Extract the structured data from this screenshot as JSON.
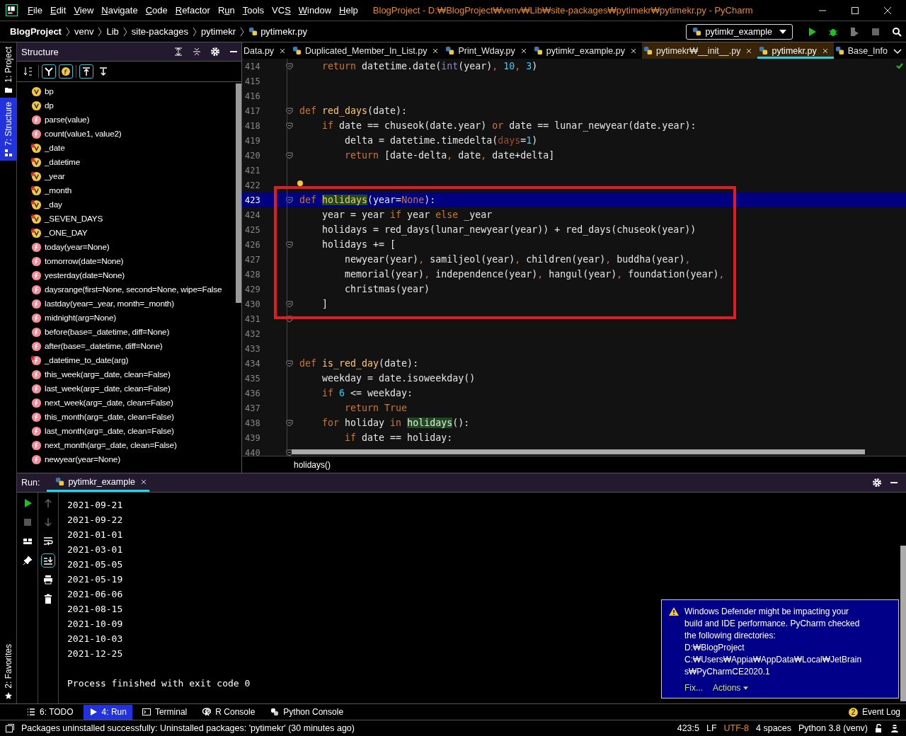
{
  "window": {
    "title": "BlogProject - D:₩BlogProject₩venv₩Lib₩site-packages₩pytimekr₩pytimekr.py - PyCharm"
  },
  "menu": [
    {
      "key": "F",
      "after": "ile"
    },
    {
      "key": "E",
      "after": "dit"
    },
    {
      "key": "V",
      "after": "iew"
    },
    {
      "key": "N",
      "after": "avigate"
    },
    {
      "key": "C",
      "after": "ode"
    },
    {
      "key": "R",
      "after": "efactor"
    },
    {
      "before": "R",
      "key": "u",
      "after": "n"
    },
    {
      "key": "T",
      "after": "ools"
    },
    {
      "before": "VC",
      "key": "S"
    },
    {
      "key": "W",
      "after": "indow"
    },
    {
      "key": "H",
      "after": "elp"
    }
  ],
  "breadcrumbs": [
    {
      "label": "BlogProject",
      "kind": "root"
    },
    {
      "label": "venv",
      "kind": "folder"
    },
    {
      "label": "Lib",
      "kind": "folder"
    },
    {
      "label": "site-packages",
      "kind": "folder"
    },
    {
      "label": "pytimekr",
      "kind": "folder"
    },
    {
      "label": "pytimekr.py",
      "kind": "file"
    }
  ],
  "run_config": {
    "label": "pytimkr_example"
  },
  "side_stripe": [
    {
      "label": "1: Project",
      "selected": false
    },
    {
      "label": "7: Structure",
      "selected": true
    }
  ],
  "favorites": {
    "label": "2: Favorites"
  },
  "structure": {
    "title": "Structure",
    "toolbar": [
      {
        "kind": "sort",
        "on": false
      },
      {
        "kind": "fields",
        "on": true
      },
      {
        "kind": "func",
        "on": true
      },
      {
        "kind": "up",
        "on": true
      },
      {
        "kind": "down",
        "on": false
      }
    ],
    "items": [
      {
        "label": "bp",
        "kind": "var",
        "private": false
      },
      {
        "label": "dp",
        "kind": "var",
        "private": false
      },
      {
        "label": "parse(value)",
        "kind": "func",
        "private": false
      },
      {
        "label": "count(value1, value2)",
        "kind": "func",
        "private": false
      },
      {
        "label": "_date",
        "kind": "var",
        "private": true
      },
      {
        "label": "_datetime",
        "kind": "var",
        "private": true
      },
      {
        "label": "_year",
        "kind": "var",
        "private": true
      },
      {
        "label": "_month",
        "kind": "var",
        "private": true
      },
      {
        "label": "_day",
        "kind": "var",
        "private": true
      },
      {
        "label": "_SEVEN_DAYS",
        "kind": "var",
        "private": true
      },
      {
        "label": "_ONE_DAY",
        "kind": "var",
        "private": true
      },
      {
        "label": "today(year=None)",
        "kind": "func",
        "private": false
      },
      {
        "label": "tomorrow(date=None)",
        "kind": "func",
        "private": false
      },
      {
        "label": "yesterday(date=None)",
        "kind": "func",
        "private": false
      },
      {
        "label": "daysrange(first=None, second=None, wipe=False",
        "kind": "func",
        "private": false
      },
      {
        "label": "lastday(year=_year, month=_month)",
        "kind": "func",
        "private": false
      },
      {
        "label": "midnight(arg=None)",
        "kind": "func",
        "private": false
      },
      {
        "label": "before(base=_datetime, diff=None)",
        "kind": "func",
        "private": false
      },
      {
        "label": "after(base=_datetime, diff=None)",
        "kind": "func",
        "private": false
      },
      {
        "label": "_datetime_to_date(arg)",
        "kind": "func",
        "private": true
      },
      {
        "label": "this_week(arg=_date, clean=False)",
        "kind": "func",
        "private": false
      },
      {
        "label": "last_week(arg=_date, clean=False)",
        "kind": "func",
        "private": false
      },
      {
        "label": "next_week(arg=_date, clean=False)",
        "kind": "func",
        "private": false
      },
      {
        "label": "this_month(arg=_date, clean=False)",
        "kind": "func",
        "private": false
      },
      {
        "label": "last_month(arg=_date, clean=False)",
        "kind": "func",
        "private": false
      },
      {
        "label": "next_month(arg=_date, clean=False)",
        "kind": "func",
        "private": false
      },
      {
        "label": "newyear(year=None)",
        "kind": "func",
        "private": false
      }
    ]
  },
  "editor_tabs": [
    {
      "label": "Data.py",
      "selected": false,
      "library": false,
      "icon": false
    },
    {
      "label": "Duplicated_Member_In_List.py",
      "selected": false,
      "library": false,
      "icon": true
    },
    {
      "label": "Print_Wday.py",
      "selected": false,
      "library": false,
      "icon": true
    },
    {
      "label": "pytimkr_example.py",
      "selected": false,
      "library": false,
      "icon": true
    },
    {
      "label": "pytimekr₩__init__.py",
      "selected": false,
      "library": true,
      "icon": true
    },
    {
      "label": "pytimekr.py",
      "selected": true,
      "library": true,
      "icon": true
    },
    {
      "label": "Base_Info",
      "selected": false,
      "library": false,
      "icon": true
    }
  ],
  "code_lines": [
    {
      "number": "414",
      "fold": true,
      "selected": false,
      "code": [
        {
          "text": "    return",
          "kind": "kw"
        },
        {
          "text": " datetime.date(",
          "kind": "p"
        },
        {
          "text": "int",
          "kind": "bi"
        },
        {
          "text": "(year)",
          "kind": "p"
        },
        {
          "text": ", ",
          "kind": "kw"
        },
        {
          "text": "10",
          "kind": "num"
        },
        {
          "text": ", ",
          "kind": "kw"
        },
        {
          "text": "3",
          "kind": "num"
        },
        {
          "text": ")",
          "kind": "p"
        }
      ]
    },
    {
      "number": "415",
      "fold": false,
      "selected": false
    },
    {
      "number": "416",
      "fold": false,
      "selected": false
    },
    {
      "number": "417",
      "fold": true,
      "selected": false,
      "code": [
        {
          "text": "def ",
          "kind": "kw"
        },
        {
          "text": "red_days",
          "kind": "fn"
        },
        {
          "text": "(date):",
          "kind": "p"
        }
      ]
    },
    {
      "number": "418",
      "fold": true,
      "selected": false,
      "code": [
        {
          "text": "    if",
          "kind": "kw"
        },
        {
          "text": " date == chuseok(date.year) ",
          "kind": "p"
        },
        {
          "text": "or",
          "kind": "kw"
        },
        {
          "text": " date == lunar_newyear(date.year):",
          "kind": "p"
        }
      ]
    },
    {
      "number": "419",
      "fold": false,
      "selected": false,
      "code": [
        {
          "text": "        delta = datetime.timedelta(",
          "kind": "p"
        },
        {
          "text": "days",
          "kind": "kwarg"
        },
        {
          "text": "=",
          "kind": "p"
        },
        {
          "text": "1",
          "kind": "num"
        },
        {
          "text": ")",
          "kind": "p"
        }
      ]
    },
    {
      "number": "420",
      "fold": true,
      "selected": false,
      "code": [
        {
          "text": "        return",
          "kind": "kw"
        },
        {
          "text": " [date-delta",
          "kind": "p"
        },
        {
          "text": ", ",
          "kind": "kw"
        },
        {
          "text": "date",
          "kind": "p"
        },
        {
          "text": ", ",
          "kind": "kw"
        },
        {
          "text": "date+delta]",
          "kind": "p"
        }
      ]
    },
    {
      "number": "421",
      "fold": false,
      "selected": false
    },
    {
      "number": "422",
      "fold": false,
      "selected": false
    },
    {
      "number": "423",
      "fold": true,
      "selected": true,
      "code": [
        {
          "text": "def ",
          "kind": "kw"
        },
        {
          "text": "holidays",
          "kind": "fnhl"
        },
        {
          "text": "(year=",
          "kind": "p"
        },
        {
          "text": "None",
          "kind": "kw"
        },
        {
          "text": "):",
          "kind": "p"
        }
      ]
    },
    {
      "number": "424",
      "fold": false,
      "selected": false,
      "code": [
        {
          "text": "    year = year ",
          "kind": "p"
        },
        {
          "text": "if",
          "kind": "kw"
        },
        {
          "text": " year ",
          "kind": "p"
        },
        {
          "text": "else",
          "kind": "kw"
        },
        {
          "text": " _year",
          "kind": "p"
        }
      ]
    },
    {
      "number": "425",
      "fold": false,
      "selected": false,
      "code": [
        {
          "text": "    holidays = red_days(lunar_newyear(year)) + red_days(chuseok(year))",
          "kind": "p"
        }
      ]
    },
    {
      "number": "426",
      "fold": true,
      "selected": false,
      "code": [
        {
          "text": "    holidays += [",
          "kind": "p"
        }
      ]
    },
    {
      "number": "427",
      "fold": false,
      "selected": false,
      "code": [
        {
          "text": "        newyear(year)",
          "kind": "p"
        },
        {
          "text": ", ",
          "kind": "kw"
        },
        {
          "text": "samiljeol(year)",
          "kind": "p"
        },
        {
          "text": ", ",
          "kind": "kw"
        },
        {
          "text": "children(year)",
          "kind": "p"
        },
        {
          "text": ", ",
          "kind": "kw"
        },
        {
          "text": "buddha(year)",
          "kind": "p"
        },
        {
          "text": ",",
          "kind": "kw"
        }
      ]
    },
    {
      "number": "428",
      "fold": false,
      "selected": false,
      "code": [
        {
          "text": "        memorial(year)",
          "kind": "p"
        },
        {
          "text": ", ",
          "kind": "kw"
        },
        {
          "text": "independence(year)",
          "kind": "p"
        },
        {
          "text": ", ",
          "kind": "kw"
        },
        {
          "text": "hangul(year)",
          "kind": "p"
        },
        {
          "text": ", ",
          "kind": "kw"
        },
        {
          "text": "foundation(year)",
          "kind": "p"
        },
        {
          "text": ",",
          "kind": "kw"
        }
      ]
    },
    {
      "number": "429",
      "fold": false,
      "selected": false,
      "code": [
        {
          "text": "        christmas(year)",
          "kind": "p"
        }
      ]
    },
    {
      "number": "430",
      "fold": true,
      "selected": false,
      "code": [
        {
          "text": "    ]",
          "kind": "p"
        }
      ]
    },
    {
      "number": "431",
      "fold": true,
      "selected": false
    },
    {
      "number": "432",
      "fold": false,
      "selected": false
    },
    {
      "number": "433",
      "fold": false,
      "selected": false
    },
    {
      "number": "434",
      "fold": true,
      "selected": false,
      "code": [
        {
          "text": "def ",
          "kind": "kw"
        },
        {
          "text": "is_red_day",
          "kind": "fn"
        },
        {
          "text": "(date):",
          "kind": "p"
        }
      ]
    },
    {
      "number": "435",
      "fold": false,
      "selected": false,
      "code": [
        {
          "text": "    weekday = date.isoweekday()",
          "kind": "p"
        }
      ]
    },
    {
      "number": "436",
      "fold": false,
      "selected": false,
      "code": [
        {
          "text": "    if ",
          "kind": "kw"
        },
        {
          "text": "6",
          "kind": "num"
        },
        {
          "text": " <= weekday:",
          "kind": "p"
        }
      ]
    },
    {
      "number": "437",
      "fold": false,
      "selected": false,
      "code": [
        {
          "text": "        return True",
          "kind": "kw"
        }
      ]
    },
    {
      "number": "438",
      "fold": true,
      "selected": false,
      "code": [
        {
          "text": "    for",
          "kind": "kw"
        },
        {
          "text": " holiday ",
          "kind": "p"
        },
        {
          "text": "in ",
          "kind": "kw"
        },
        {
          "text": "holidays",
          "kind": "usehl"
        },
        {
          "text": "():",
          "kind": "p"
        }
      ]
    },
    {
      "number": "439",
      "fold": false,
      "selected": false,
      "code": [
        {
          "text": "        if",
          "kind": "kw"
        },
        {
          "text": " date == holiday:",
          "kind": "p"
        }
      ]
    },
    {
      "number": "440",
      "fold": true,
      "selected": false
    }
  ],
  "editor_breadcrumb": "holidays()",
  "run": {
    "label": "Run:",
    "tab": "pytimkr_example",
    "output": [
      "2021-09-21",
      "2021-09-22",
      "2021-01-01",
      "2021-03-01",
      "2021-05-05",
      "2021-05-19",
      "2021-06-06",
      "2021-08-15",
      "2021-10-09",
      "2021-10-03",
      "2021-12-25"
    ],
    "exit_message": "Process finished with exit code 0"
  },
  "notification": {
    "message": "Windows Defender might be impacting your build and IDE performance. PyCharm checked the following directories:",
    "directories": [
      "D:₩BlogProject",
      "C:₩Users₩Appia₩AppData₩Local₩JetBrains₩PyCharmCE2020.1"
    ],
    "actions": [
      "Fix...",
      "Actions"
    ]
  },
  "tool_tabs": [
    {
      "label": "6: TODO",
      "kind": "list",
      "selected": false
    },
    {
      "label": "4: Run",
      "kind": "run",
      "selected": true
    },
    {
      "label": "Terminal",
      "kind": "terminal",
      "selected": false
    },
    {
      "label": "R Console",
      "kind": "r",
      "selected": false
    },
    {
      "label": "Python Console",
      "kind": "python",
      "selected": false
    }
  ],
  "event_log": {
    "label": "Event Log",
    "count": "2"
  },
  "status_bar": {
    "message": "Packages uninstalled successfully: Uninstalled packages: 'pytimekr' (30 minutes ago)",
    "position": "423:5",
    "line_separator": "LF",
    "encoding": "UTF-8",
    "indent": "4 spaces",
    "interpreter": "Python 3.8 (venv)"
  }
}
